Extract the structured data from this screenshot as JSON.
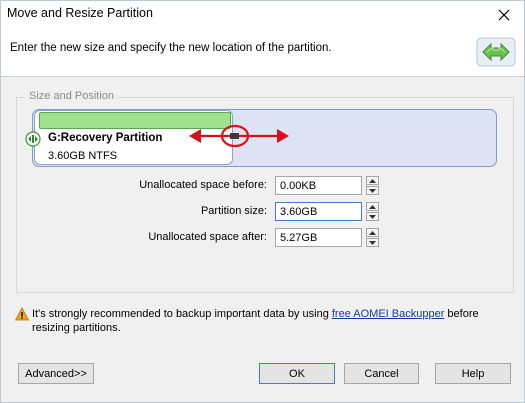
{
  "window": {
    "title": "Move and Resize Partition"
  },
  "header": {
    "instruction": "Enter the new size and specify the new location of the partition."
  },
  "group": {
    "legend": "Size and Position"
  },
  "partition": {
    "name": "G:Recovery Partition",
    "size_fs": "3.60GB NTFS",
    "bar_color": "#9fe08f"
  },
  "fields": {
    "unalloc_before": {
      "label": "Unallocated space before:",
      "value": "0.00KB"
    },
    "partition_size": {
      "label": "Partition size:",
      "value": "3.60GB"
    },
    "unalloc_after": {
      "label": "Unallocated space after:",
      "value": "5.27GB"
    }
  },
  "warning": {
    "text_before": "It's strongly recommended to backup important data by using ",
    "link": "free AOMEI Backupper",
    "text_after": " before resizing partitions."
  },
  "buttons": {
    "advanced": "Advanced>>",
    "ok": "OK",
    "cancel": "Cancel",
    "help": "Help"
  },
  "icons": {
    "close": "close-icon",
    "header": "resize-arrows-icon",
    "partition": "partition-drag-icon",
    "warning": "warning-icon",
    "annotation": "red-drag-arrow-annotation"
  },
  "colors": {
    "annotation": "#d9101a",
    "disk_bg": "#dde3f4",
    "link": "#0b3ea8"
  }
}
